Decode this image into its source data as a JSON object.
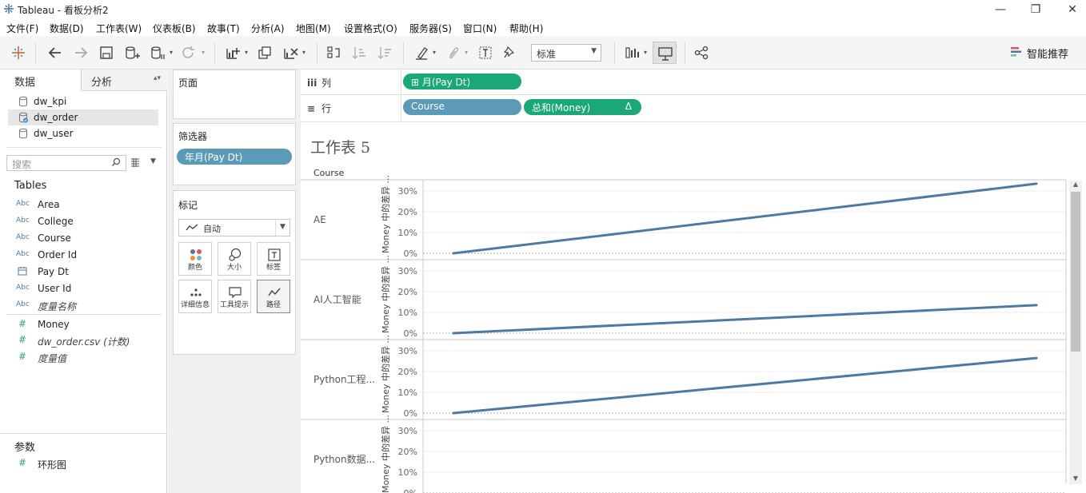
{
  "window": {
    "title": "Tableau - 看板分析2",
    "controls": [
      "—",
      "❐",
      "✕"
    ]
  },
  "menu": [
    "文件(F)",
    "数据(D)",
    "工作表(W)",
    "仪表板(B)",
    "故事(T)",
    "分析(A)",
    "地图(M)",
    "设置格式(O)",
    "服务器(S)",
    "窗口(N)",
    "帮助(H)"
  ],
  "toolbar": {
    "view_select": "标准",
    "smart_label": "智能推荐"
  },
  "datapane": {
    "tab_data": "数据",
    "tab_analysis": "分析",
    "sources": [
      {
        "label": "dw_kpi",
        "selected": false
      },
      {
        "label": "dw_order",
        "selected": true
      },
      {
        "label": "dw_user",
        "selected": false
      }
    ],
    "search_placeholder": "搜索",
    "tables_title": "Tables",
    "dimensions": [
      {
        "type": "Abc",
        "label": "Area",
        "italic": false
      },
      {
        "type": "Abc",
        "label": "College",
        "italic": false
      },
      {
        "type": "Abc",
        "label": "Course",
        "italic": false
      },
      {
        "type": "Abc",
        "label": "Order Id",
        "italic": false
      },
      {
        "type": "date",
        "label": "Pay Dt",
        "italic": false
      },
      {
        "type": "Abc",
        "label": "User Id",
        "italic": false
      },
      {
        "type": "Abc",
        "label": "度量名称",
        "italic": true
      }
    ],
    "measures": [
      {
        "type": "#",
        "label": "Money",
        "italic": false
      },
      {
        "type": "#",
        "label": "dw_order.csv (计数)",
        "italic": true
      },
      {
        "type": "#",
        "label": "度量值",
        "italic": true
      }
    ],
    "params_title": "参数",
    "params": [
      {
        "type": "#",
        "label": "环形图"
      }
    ]
  },
  "cards": {
    "pages_title": "页面",
    "filters_title": "筛选器",
    "filter_pill": "年月(Pay Dt)",
    "marks_title": "标记",
    "marks_type": "自动",
    "mark_buttons": [
      "颜色",
      "大小",
      "标签",
      "详细信息",
      "工具提示",
      "路径"
    ]
  },
  "shelves": {
    "columns_label": "列",
    "rows_label": "行",
    "columns_pills": [
      "⊞ 月(Pay Dt)"
    ],
    "rows_pills": [
      "Course",
      "总和(Money)"
    ],
    "delta": "Δ"
  },
  "sheet": {
    "title": "工作表 5",
    "row_header": "Course",
    "axis_title": "Money 中的差异 ..."
  },
  "chart_data": {
    "type": "line",
    "y_tick_labels": [
      "0%",
      "10%",
      "20%",
      "30%"
    ],
    "ylim": [
      0,
      0.35
    ],
    "grid": true,
    "panels": [
      {
        "category": "AE",
        "series": [
          {
            "x": [
              "start",
              "end"
            ],
            "values": [
              0.0,
              0.335
            ]
          }
        ]
      },
      {
        "category": "AI人工智能",
        "series": [
          {
            "x": [
              "start",
              "end"
            ],
            "values": [
              0.0,
              0.135
            ]
          }
        ]
      },
      {
        "category": "Python工程...",
        "series": [
          {
            "x": [
              "start",
              "end"
            ],
            "values": [
              0.0,
              0.265
            ]
          }
        ]
      },
      {
        "category": "Python数据...",
        "series": []
      }
    ],
    "line_color": "#4e79a7"
  }
}
